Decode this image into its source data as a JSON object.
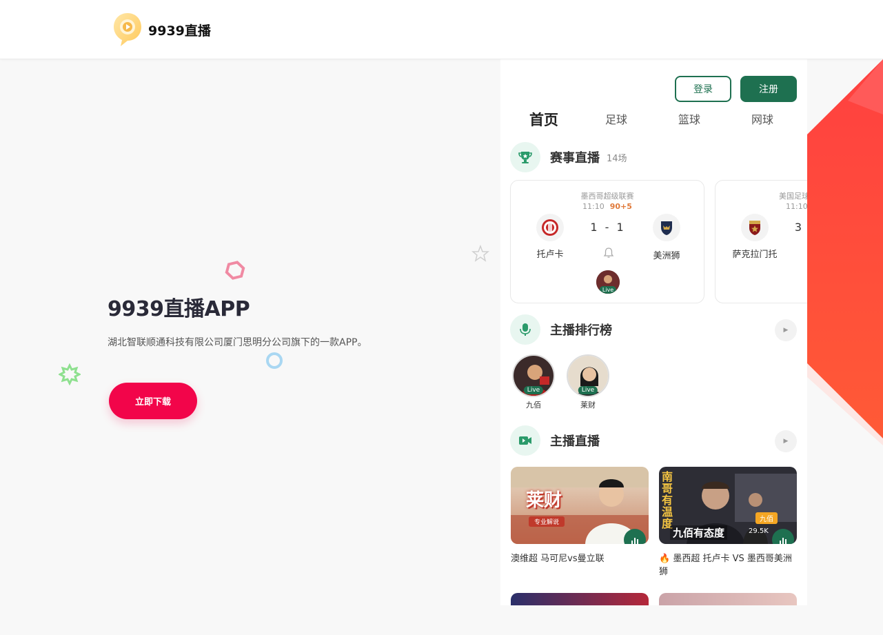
{
  "header": {
    "logo_text": "9939直播"
  },
  "hero": {
    "title": "9939直播APP",
    "description": "湖北智联顺通科技有限公司厦门思明分公司旗下的一款APP。",
    "download_label": "立即下载"
  },
  "phone": {
    "auth": {
      "login_label": "登录",
      "register_label": "注册"
    },
    "tabs": [
      "首页",
      "足球",
      "篮球",
      "网球"
    ],
    "live_section": {
      "title": "赛事直播",
      "count": "14场",
      "icon": "trophy-icon"
    },
    "matches": [
      {
        "league": "墨西哥超级联赛",
        "time": "11:10",
        "minute": "90+5",
        "home": "托卢卡",
        "away": "美洲狮",
        "score": "1 - 1",
        "live_label": "Live"
      },
      {
        "league": "美国足球",
        "time": "11:10",
        "home": "萨克拉门托",
        "score": "3"
      }
    ],
    "ranking_section": {
      "title": "主播排行榜",
      "icon": "microphone-icon"
    },
    "anchors": [
      {
        "name": "九佰",
        "live_label": "Live"
      },
      {
        "name": "莱财",
        "live_label": "Live"
      }
    ],
    "streams_section": {
      "title": "主播直播",
      "icon": "video-camera-icon"
    },
    "streams": [
      {
        "title": "澳维超 马可尼vs曼立联",
        "overlay_text": "莱财",
        "tag": "专业解说",
        "fire": false
      },
      {
        "title": "墨西超 托卢卡 VS 墨西哥美洲狮",
        "overlay_text": "九佰有态度",
        "side_text": "南哥有温度",
        "badge": "九佰",
        "viewers": "29.5K",
        "fire": true
      }
    ]
  },
  "colors": {
    "brand_green": "#1e7050",
    "download_red": "#f2054a",
    "accent_orange": "#ff5a36"
  }
}
